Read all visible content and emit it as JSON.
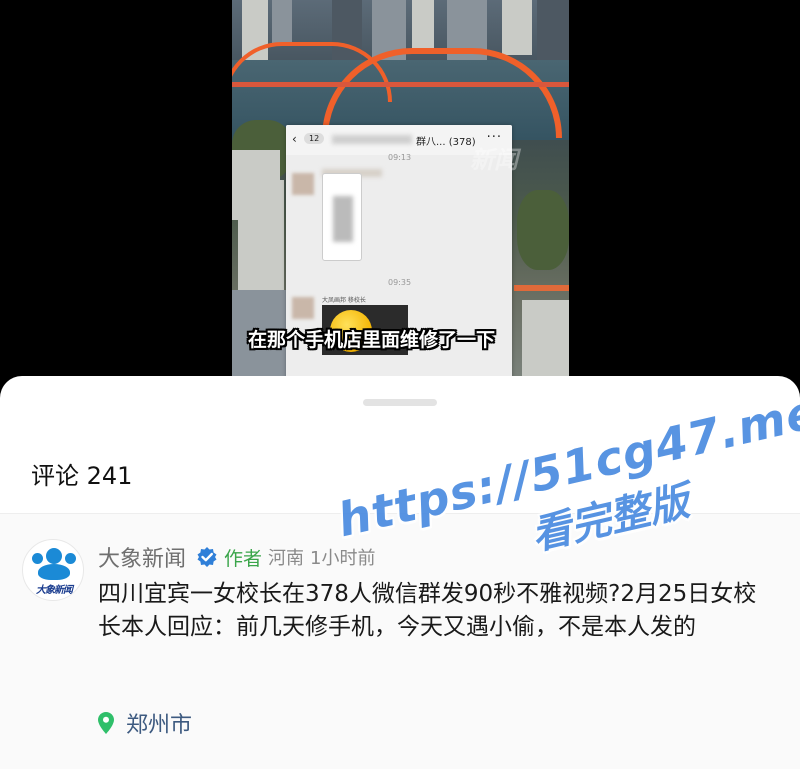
{
  "video": {
    "subtitle": "在那个手机店里面维修了一下",
    "watermark": "新闻",
    "chat_screenshot": {
      "back_count": "12",
      "name_suffix": "群八...",
      "member_count": "(378)",
      "more": "···",
      "time_1": "09:13",
      "time_2": "09:35",
      "sender_label": "大凤画邦  移校长"
    }
  },
  "sheet": {
    "comments_title": "评论 241"
  },
  "comment": {
    "author": "大象新闻",
    "author_tag": "作者",
    "region": "河南",
    "time": "1小时前",
    "avatar_text": "大象新闻",
    "body": "四川宜宾一女校长在378人微信群发90秒不雅视频?2月25日女校长本人回应：前几天修手机，今天又遇小偷，不是本人发的",
    "location": "郑州市"
  },
  "promo": {
    "line1": "https://51cg47.me",
    "line2": "看完整版"
  },
  "colors": {
    "author_tag": "#3aa54a",
    "location_text": "#3d5a80",
    "verified_badge": "#2f7fd8",
    "promo": "#4a8be0",
    "bridge": "#f0602a"
  }
}
